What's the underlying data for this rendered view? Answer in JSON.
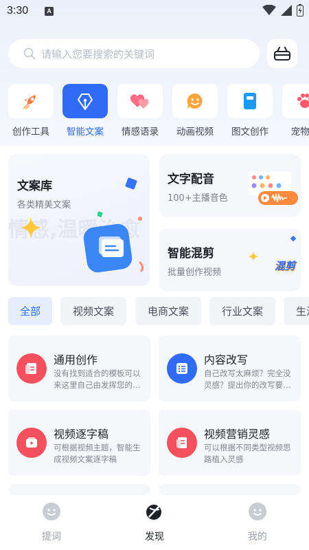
{
  "status": {
    "time": "3:30",
    "badge": "A"
  },
  "search": {
    "placeholder": "请输入您要搜索的关键词"
  },
  "categories": [
    {
      "label": "创作工具",
      "icon": "rocket-icon"
    },
    {
      "label": "智能文案",
      "icon": "pen-nib-icon",
      "active": true
    },
    {
      "label": "情感语录",
      "icon": "hearts-icon"
    },
    {
      "label": "动画视频",
      "icon": "smile-bubble-icon"
    },
    {
      "label": "图文创作",
      "icon": "notebook-icon"
    },
    {
      "label": "宠物社",
      "icon": "paw-icon"
    }
  ],
  "features": {
    "library": {
      "title": "文案库",
      "subtitle": "各类精美文案",
      "watermark": "情感,温暖治愈"
    },
    "dubbing": {
      "title": "文字配音",
      "subtitle": "100+主播音色"
    },
    "mix": {
      "title": "智能混剪",
      "subtitle": "批量创作视频",
      "badge": "混剪"
    }
  },
  "tabs": [
    {
      "label": "全部",
      "active": true
    },
    {
      "label": "视频文案"
    },
    {
      "label": "电商文案"
    },
    {
      "label": "行业文案"
    },
    {
      "label": "生活"
    }
  ],
  "tools": [
    {
      "title": "通用创作",
      "desc": "没有找到适合的模板可以来这里自己由发挥您的…",
      "color": "#f4505e",
      "icon": "document-icon"
    },
    {
      "title": "内容改写",
      "desc": "自己改写太麻烦？完全没灵感？提出你的改写要…",
      "color": "#2f6bf4",
      "icon": "list-icon"
    },
    {
      "title": "视频逐字稿",
      "desc": "可根据视频主题，智能生成视频文案逐字稿",
      "color": "#f4505e",
      "icon": "video-icon"
    },
    {
      "title": "视频营销灵感",
      "desc": "可以根据不同类型视频思路植入灵感",
      "color": "#f4505e",
      "icon": "notes-icon"
    }
  ],
  "nav": [
    {
      "label": "提词",
      "icon": "smile-icon"
    },
    {
      "label": "发现",
      "icon": "compass-icon",
      "active": true
    },
    {
      "label": "我的",
      "icon": "profile-icon"
    }
  ],
  "colors": {
    "accent": "#2f6bf4",
    "red": "#f4505e",
    "orange": "#ff8a3d"
  }
}
